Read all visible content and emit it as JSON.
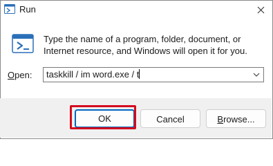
{
  "window": {
    "title": "Run"
  },
  "dialog": {
    "description": "Type the name of a program, folder, document, or Internet resource, and Windows will open it for you.",
    "open_label_accel": "O",
    "open_label_rest": "pen:",
    "open_value": "taskkill / im word.exe / t"
  },
  "buttons": {
    "ok": "OK",
    "cancel": "Cancel",
    "browse_accel": "B",
    "browse_rest": "rowse..."
  },
  "icons": {
    "app": "run-icon",
    "close": "close-icon",
    "dropdown": "chevron-down-icon"
  },
  "colors": {
    "highlight": "#d40b1e",
    "accent": "#0067c0"
  }
}
